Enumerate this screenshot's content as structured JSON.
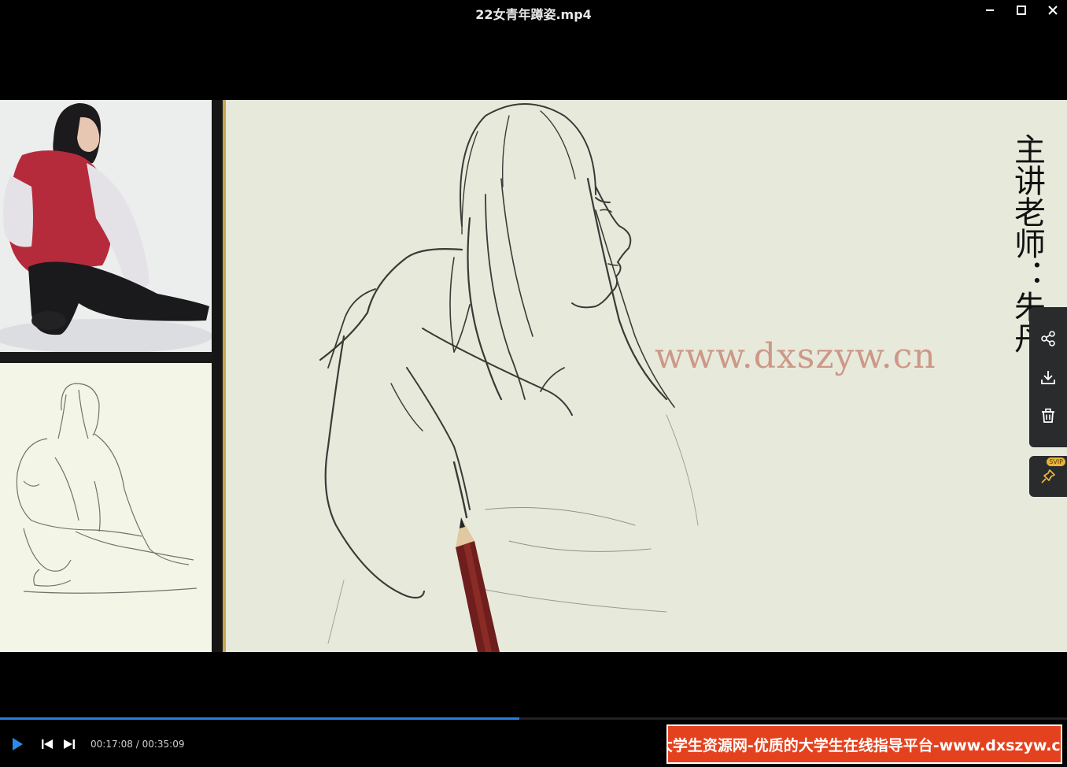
{
  "window": {
    "title": "22女青年蹲姿.mp4",
    "icons": [
      "minimize-icon",
      "maximize-icon",
      "close-icon"
    ]
  },
  "video": {
    "teacher_caption": "主讲老师：朱丹",
    "watermark": "www.dxszyw.cn"
  },
  "side_tools": [
    "share-icon",
    "download-icon",
    "delete-icon"
  ],
  "pin_tool": {
    "icon": "pin-icon",
    "badge": "SVIP"
  },
  "player": {
    "current_time": "00:17:08",
    "separator": " / ",
    "duration": "00:35:09",
    "progress_fraction": 0.487,
    "progress_color": "#2a7fe0"
  },
  "banner": {
    "text": "大学生资源网-优质的大学生在线指导平台-www.dxszyw.cn",
    "background": "#e4421f"
  }
}
